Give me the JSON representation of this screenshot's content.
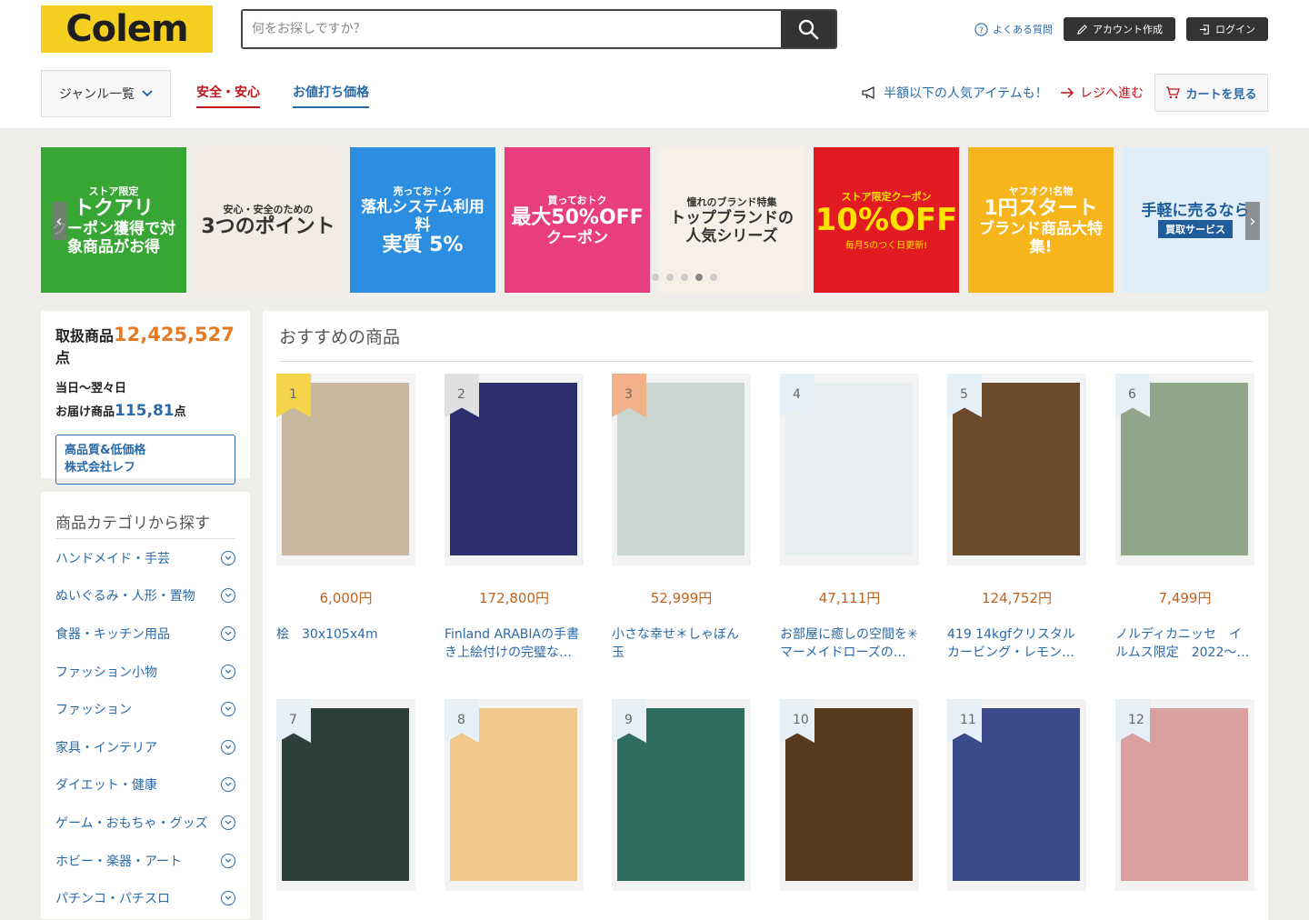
{
  "header": {
    "logo_text": "Colem",
    "search_placeholder": "何をお探しですか？",
    "faq_label": "よくある質問",
    "create_account_label": "アカウント作成",
    "login_label": "ログイン"
  },
  "nav": {
    "genre_label": "ジャンル一覧",
    "tab_safe": "安全・安心",
    "tab_price": "お値打ち価格",
    "promo_text": "半額以下の人気アイテムも！",
    "checkout_text": "レジへ進む",
    "cart_label": "カートを見る"
  },
  "banners": [
    {
      "l1": "ストア限定",
      "l2": "トクアリ",
      "l3": "クーポン獲得で対象商品がお得",
      "bg": "#37a635",
      "fg": "#ffffff"
    },
    {
      "l1": "安心・安全のための",
      "l2": "3つのポイント",
      "l3": "",
      "bg": "#f2ece4",
      "fg": "#333333"
    },
    {
      "l1": "売っておトク",
      "l2": "落札システム利用料",
      "l3": "実質 5%",
      "bg": "#2c8ee0",
      "fg": "#ffffff"
    },
    {
      "l1": "買っておトク",
      "l2": "最大50%OFF",
      "l3": "クーポン",
      "bg": "#e83e7e",
      "fg": "#ffffff"
    },
    {
      "l1": "憧れのブランド特集",
      "l2": "トップブランドの",
      "l3": "人気シリーズ",
      "bg": "#f6f0e6",
      "fg": "#333333"
    },
    {
      "l1": "ストア限定クーポン",
      "l2": "10%OFF",
      "l3": "毎月5のつく日更新!",
      "bg": "#e21a22",
      "fg": "#ffe200"
    },
    {
      "l1": "ヤフオク!名物",
      "l2": "1円スタート",
      "l3": "ブランド商品大特集!",
      "bg": "#f7b51c",
      "fg": "#ffffff"
    },
    {
      "l1": "手軽に売るなら",
      "l2": "買取サービス",
      "l3": "",
      "bg": "#dfeef8",
      "fg": "#1e5d9a"
    }
  ],
  "stats": {
    "total_label": "取扱商品",
    "total_value": "12,425,527",
    "total_unit": "点",
    "delivery_line1": "当日〜翌々日",
    "delivery_label": "お届け商品",
    "delivery_value": "115,81",
    "delivery_unit": "点",
    "shop_line1": "高品質&低価格",
    "shop_line2": "株式会社レフ"
  },
  "categories": {
    "title": "商品カテゴリから探す",
    "items": [
      "ハンドメイド・手芸",
      "ぬいぐるみ・人形・置物",
      "食器・キッチン用品",
      "ファッション小物",
      "ファッション",
      "家具・インテリア",
      "ダイエット・健康",
      "ゲーム・おもちゃ・グッズ",
      "ホビー・楽器・アート",
      "パチンコ・パチスロ"
    ]
  },
  "main": {
    "title": "おすすめの商品",
    "products": [
      {
        "rank": "1",
        "price": "6,000円",
        "name": "桧　30x105x4m",
        "rank_bg": "#f5d44a",
        "img": "#c8b79f"
      },
      {
        "rank": "2",
        "price": "172,800円",
        "name": "Finland ARABIAの手書き上絵付けの完璧な…",
        "rank_bg": "#e0e0e0",
        "img": "#2b2f6e"
      },
      {
        "rank": "3",
        "price": "52,999円",
        "name": "小さな幸せ＊しゃぼん玉",
        "rank_bg": "#f2b189",
        "img": "#c9d6cf"
      },
      {
        "rank": "4",
        "price": "47,111円",
        "name": "お部屋に癒しの空間を✳︎マーメイドローズの…",
        "rank_bg": "#e6f0f8",
        "img": "#e9eff0"
      },
      {
        "rank": "5",
        "price": "124,752円",
        "name": "419 14kgfクリスタルカービング・レモンク…",
        "rank_bg": "#e6f0f8",
        "img": "#6b4a2c"
      },
      {
        "rank": "6",
        "price": "7,499円",
        "name": "ノルディカニッセ　イルムス限定　2022〜…",
        "rank_bg": "#e6f0f8",
        "img": "#8fa68a"
      },
      {
        "rank": "7",
        "price": "",
        "name": "",
        "rank_bg": "#e6f0f8",
        "img": "#2d3f3a"
      },
      {
        "rank": "8",
        "price": "",
        "name": "",
        "rank_bg": "#e6f0f8",
        "img": "#f0c98a"
      },
      {
        "rank": "9",
        "price": "",
        "name": "",
        "rank_bg": "#e6f0f8",
        "img": "#2f6e5e"
      },
      {
        "rank": "10",
        "price": "",
        "name": "",
        "rank_bg": "#e6f0f8",
        "img": "#5a3a1f"
      },
      {
        "rank": "11",
        "price": "",
        "name": "",
        "rank_bg": "#e6f0f8",
        "img": "#3a4a8a"
      },
      {
        "rank": "12",
        "price": "",
        "name": "",
        "rank_bg": "#e6f0f8",
        "img": "#d9a0a0"
      }
    ]
  }
}
